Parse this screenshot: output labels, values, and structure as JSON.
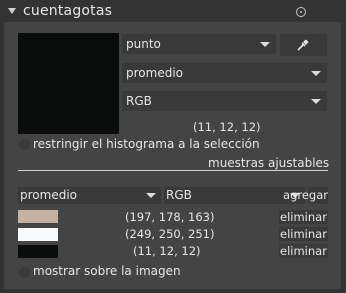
{
  "header": {
    "title": "cuentagotas",
    "reset_icon": "reset-icon"
  },
  "picker": {
    "swatch_color": "#0b0c0c",
    "mode": {
      "selected": "punto"
    },
    "statistic": {
      "selected": "promedio"
    },
    "color_space": {
      "selected": "RGB"
    },
    "value": "(11, 12, 12)",
    "picker_icon": "color-picker-icon",
    "restrict_label": "restringir el histograma a la selección"
  },
  "samples": {
    "section_label": "muestras ajustables",
    "statistic": {
      "selected": "promedio"
    },
    "color_space": {
      "selected": "RGB"
    },
    "add_label": "agregar",
    "items": [
      {
        "color": "#c5b2a3",
        "value": "(197, 178, 163)",
        "remove_label": "eliminar"
      },
      {
        "color": "#f9fafb",
        "value": "(249, 250, 251)",
        "remove_label": "eliminar"
      },
      {
        "color": "#0b0c0c",
        "value": "(11, 12, 12)",
        "remove_label": "eliminar"
      }
    ],
    "show_label": "mostrar sobre la imagen"
  }
}
